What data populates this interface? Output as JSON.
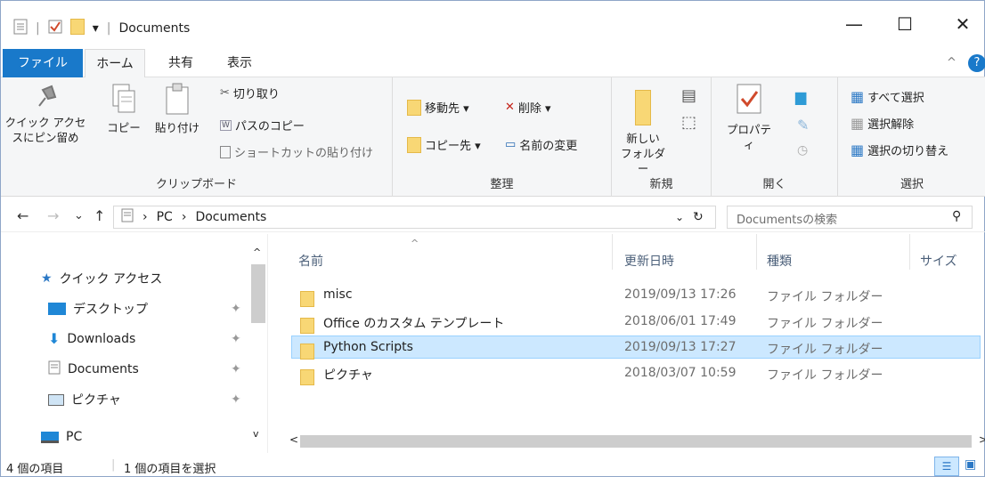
{
  "window": {
    "title": "Documents",
    "minimize": "—",
    "maximize": "☐",
    "close": "✕"
  },
  "tabs": {
    "file": "ファイル",
    "home": "ホーム",
    "share": "共有",
    "view": "表示"
  },
  "ribbon": {
    "clipboard": {
      "pin": "クイック アクセスにピン留め",
      "copy": "コピー",
      "paste": "貼り付け",
      "cut": "切り取り",
      "copy_path": "パスのコピー",
      "paste_shortcut": "ショートカットの貼り付け",
      "group": "クリップボード"
    },
    "organize": {
      "move_to": "移動先 ▾",
      "delete": "削除 ▾",
      "copy_to": "コピー先 ▾",
      "rename": "名前の変更",
      "group": "整理"
    },
    "new": {
      "new_folder": "新しい フォルダー",
      "group": "新規"
    },
    "open": {
      "properties": "プロパティ",
      "group": "開く"
    },
    "select": {
      "select_all": "すべて選択",
      "select_none": "選択解除",
      "invert": "選択の切り替え",
      "group": "選択"
    }
  },
  "address": {
    "back": "←",
    "forward": "→",
    "recent": "⌄",
    "up": "↑",
    "crumbs": [
      "PC",
      "Documents"
    ],
    "search_placeholder": "Documentsの検索"
  },
  "nav": {
    "items": [
      {
        "label": "クイック アクセス",
        "icon": "star-icon"
      },
      {
        "label": "デスクトップ",
        "icon": "desktop-icon"
      },
      {
        "label": "Downloads",
        "icon": "download-icon"
      },
      {
        "label": "Documents",
        "icon": "document-icon"
      },
      {
        "label": "ピクチャ",
        "icon": "picture-icon"
      },
      {
        "label": "PC",
        "icon": "pc-icon"
      }
    ]
  },
  "columns": {
    "name": "名前",
    "modified": "更新日時",
    "type": "種類",
    "size": "サイズ"
  },
  "files": [
    {
      "name": "misc",
      "modified": "2019/09/13 17:26",
      "type": "ファイル フォルダー"
    },
    {
      "name": "Office のカスタム テンプレート",
      "modified": "2018/06/01 17:49",
      "type": "ファイル フォルダー"
    },
    {
      "name": "Python Scripts",
      "modified": "2019/09/13 17:27",
      "type": "ファイル フォルダー",
      "selected": true
    },
    {
      "name": "ピクチャ",
      "modified": "2018/03/07 10:59",
      "type": "ファイル フォルダー"
    }
  ],
  "status": {
    "count": "4 個の項目",
    "selected": "1 個の項目を選択"
  },
  "colors": {
    "accent": "#1979ca",
    "selection": "#cce8ff"
  }
}
